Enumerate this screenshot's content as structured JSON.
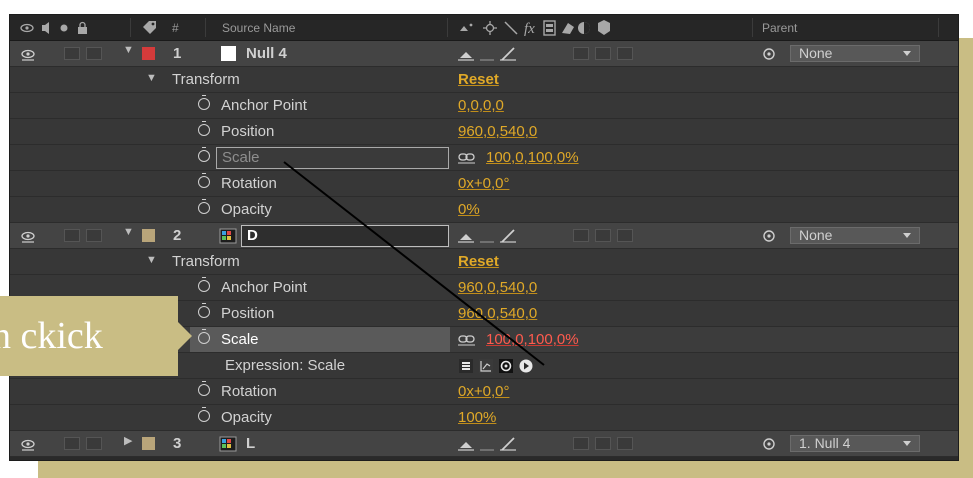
{
  "header": {
    "source_name": "Source Name",
    "parent": "Parent",
    "hash": "#",
    "fx": "fx"
  },
  "layers": [
    {
      "number": "1",
      "name": "Null 4",
      "swatch": "#d43b3b",
      "parent": "None"
    },
    {
      "number": "2",
      "name": "D",
      "swatch": "#b9a57a",
      "parent": "None"
    },
    {
      "number": "3",
      "name": "L",
      "swatch": "#b9a57a",
      "parent": "1. Null 4"
    }
  ],
  "layer1": {
    "transform": "Transform",
    "reset": "Reset",
    "anchor_point": {
      "label": "Anchor Point",
      "value": "0,0,0,0"
    },
    "position": {
      "label": "Position",
      "value": "960,0,540,0"
    },
    "scale": {
      "label": "Scale",
      "value": "100,0,100,0%"
    },
    "rotation": {
      "label": "Rotation",
      "value": "0x+0,0°"
    },
    "opacity": {
      "label": "Opacity",
      "value": "0%"
    }
  },
  "layer2": {
    "transform": "Transform",
    "reset": "Reset",
    "anchor_point": {
      "label": "Anchor Point",
      "value": "960,0,540,0"
    },
    "position": {
      "label": "Position",
      "value": "960,0,540,0"
    },
    "scale": {
      "label": "Scale",
      "value": "100,0,100,0%"
    },
    "expression": "Expression: Scale",
    "rotation": {
      "label": "Rotation",
      "value": "0x+0,0°"
    },
    "opacity": {
      "label": "Opacity",
      "value": "100%"
    }
  },
  "callout": {
    "text": "n ckick"
  },
  "colors": {
    "gold": "#e0a928",
    "expression_red": "#ff5b4e",
    "callout_bg": "#c9bd84"
  }
}
